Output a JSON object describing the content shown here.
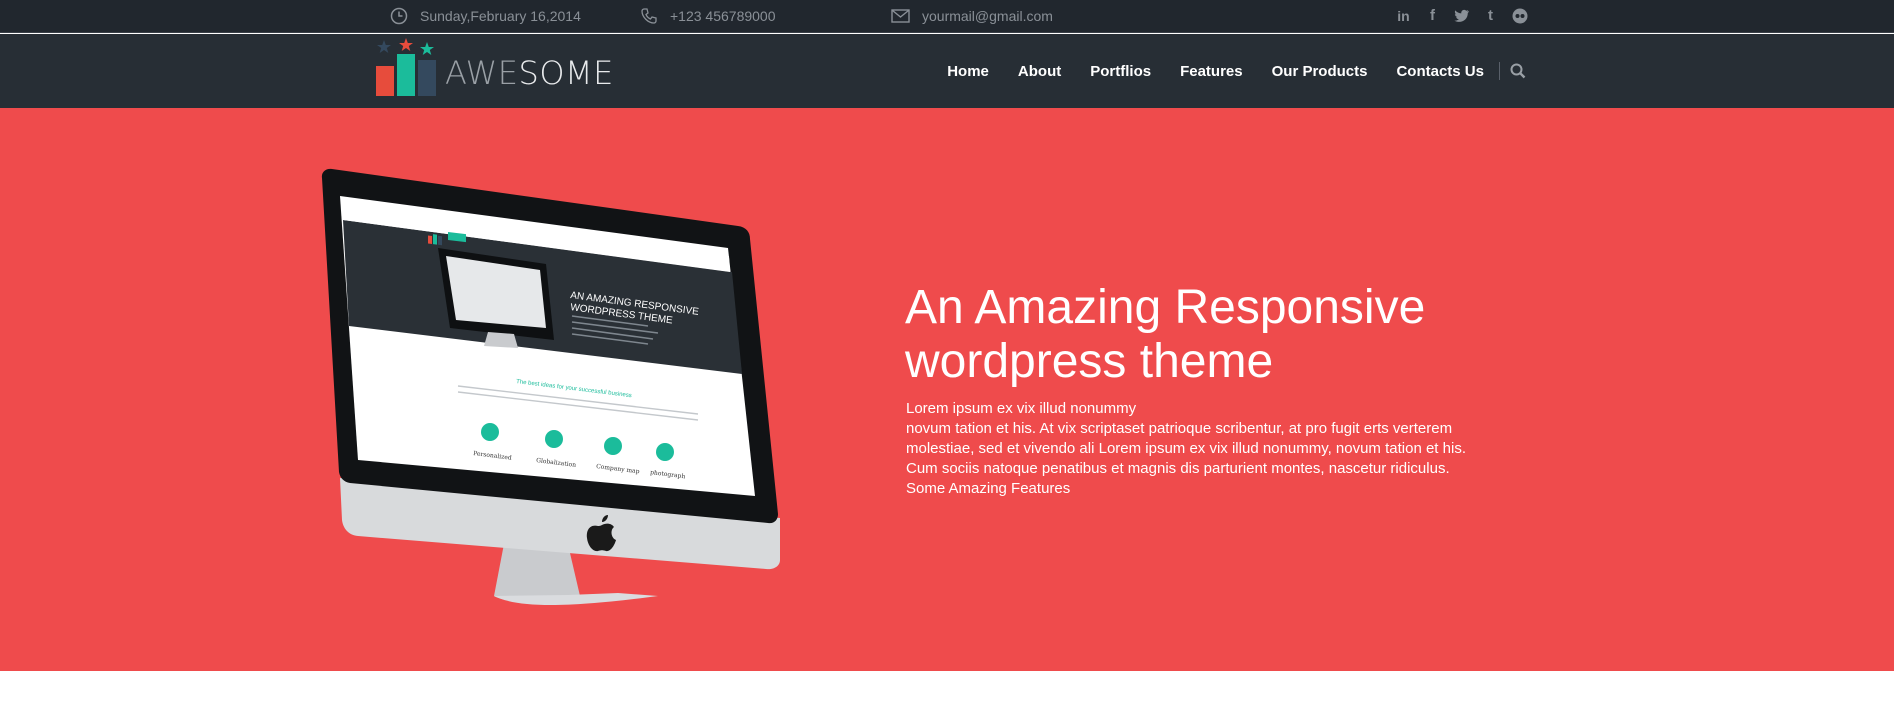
{
  "topbar": {
    "date": "Sunday,February 16,2014",
    "phone": "+123 456789000",
    "email": "yourmail@gmail.com",
    "socials": [
      {
        "icon": "linkedin-icon",
        "glyph": "in"
      },
      {
        "icon": "facebook-icon",
        "glyph": "f"
      },
      {
        "icon": "twitter-icon",
        "glyph": "t"
      },
      {
        "icon": "tumblr-icon",
        "glyph": "t"
      },
      {
        "icon": "flickr-icon",
        "glyph": "••"
      }
    ]
  },
  "header": {
    "logo_light": "AWE",
    "logo_bold": "SOME",
    "nav": [
      "Home",
      "About",
      "Portflios",
      "Features",
      "Our Products",
      "Contacts Us"
    ]
  },
  "hero": {
    "title_line1": "An Amazing Responsive",
    "title_line2": "wordpress theme",
    "text_lines": [
      "Lorem ipsum ex vix illud nonummy",
      "novum tation et his. At vix scriptaset patrioque scribentur, at pro fugit erts verterem",
      "molestiae, sed et vivendo ali Lorem ipsum ex vix illud nonummy, novum tation et his.",
      "Cum sociis natoque penatibus et magnis dis parturient montes, nascetur ridiculus.",
      "Some Amazing Features"
    ],
    "screen": {
      "heading_line1": "AN AMAZING RESPONSIVE",
      "heading_line2": "WORDPRESS THEME",
      "tagline": "The best ideas for your successful business",
      "features": [
        "Personalized",
        "Globalization",
        "Company map",
        "photograph"
      ]
    }
  },
  "colors": {
    "topbar": "#21272e",
    "header": "#272e35",
    "hero": "#ef4b4c",
    "accent_teal": "#1bbc9b",
    "accent_red": "#e74c3c",
    "accent_blue": "#34495e"
  }
}
